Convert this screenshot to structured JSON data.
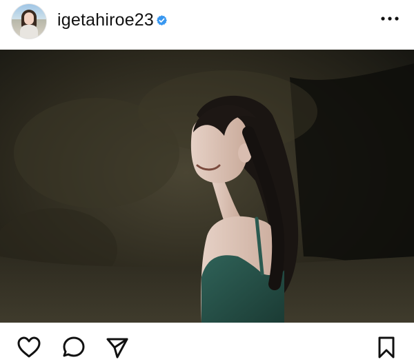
{
  "post": {
    "author": {
      "username": "igetahiroe23",
      "verified": true,
      "avatar_icon": "profile-avatar"
    },
    "header_icons": {
      "verified": "verified-badge-icon",
      "more": "more-options-icon"
    },
    "photo": {
      "icon": "post-photo"
    },
    "actions": {
      "like": "heart-icon",
      "comment": "comment-bubble-icon",
      "share": "send-paper-plane-icon",
      "save": "bookmark-icon"
    },
    "colors": {
      "verified_blue": "#3897f0",
      "text": "#111111",
      "background": "#ffffff"
    }
  }
}
